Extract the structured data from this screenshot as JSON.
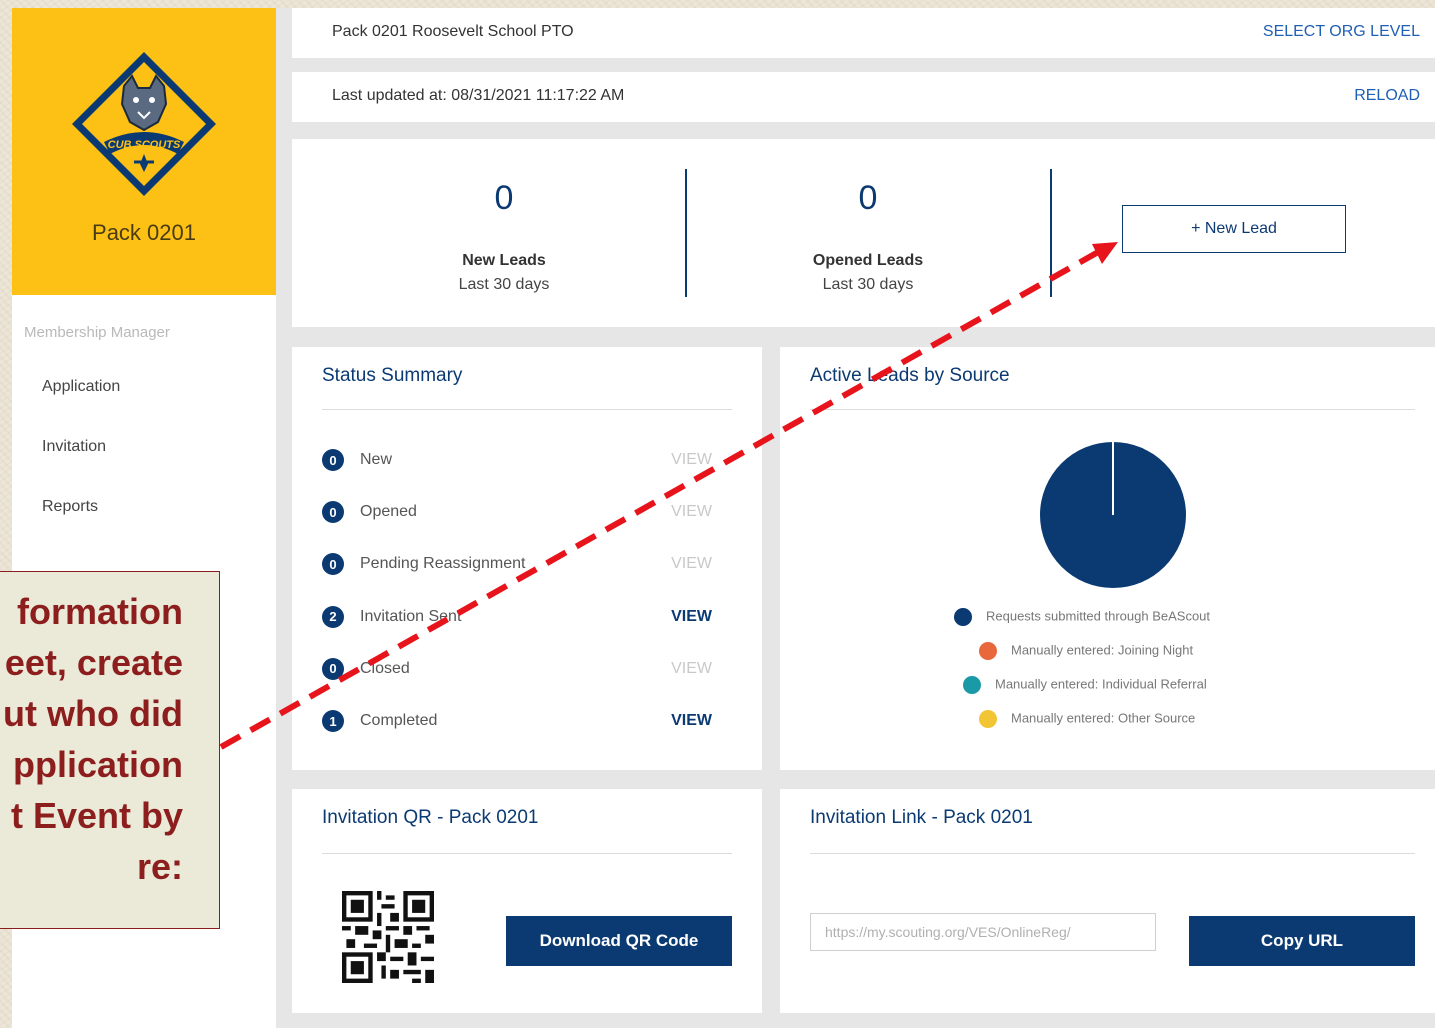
{
  "sidebar": {
    "pack_name": "Pack 0201",
    "section_label": "Membership Manager",
    "items": [
      {
        "label": "Application"
      },
      {
        "label": "Invitation"
      },
      {
        "label": "Reports"
      }
    ]
  },
  "header": {
    "org_name": "Pack 0201 Roosevelt School PTO",
    "select_org_level": "SELECT ORG LEVEL",
    "last_updated": "Last updated at: 08/31/2021 11:17:22 AM",
    "reload": "RELOAD"
  },
  "stats": {
    "new_leads": {
      "count": "0",
      "label": "New Leads",
      "period": "Last 30 days"
    },
    "opened_leads": {
      "count": "0",
      "label": "Opened Leads",
      "period": "Last 30 days"
    },
    "new_lead_button": "+ New Lead"
  },
  "status_summary": {
    "title": "Status Summary",
    "rows": [
      {
        "count": "0",
        "label": "New",
        "view": "VIEW",
        "active": false
      },
      {
        "count": "0",
        "label": "Opened",
        "view": "VIEW",
        "active": false
      },
      {
        "count": "0",
        "label": "Pending Reassignment",
        "view": "VIEW",
        "active": false
      },
      {
        "count": "2",
        "label": "Invitation Sent",
        "view": "VIEW",
        "active": true
      },
      {
        "count": "0",
        "label": "Closed",
        "view": "VIEW",
        "active": false
      },
      {
        "count": "1",
        "label": "Completed",
        "view": "VIEW",
        "active": true
      }
    ]
  },
  "chart_data": {
    "type": "pie",
    "title": "Active Leads by Source",
    "categories": [
      "Requests submitted through BeAScout",
      "Manually entered: Joining Night",
      "Manually entered: Individual Referral",
      "Manually entered: Other Source"
    ],
    "values": [
      1,
      0,
      0,
      0
    ],
    "colors": [
      "#0b3a73",
      "#e8673b",
      "#1a9aa6",
      "#f2c535"
    ],
    "legend": "bottom"
  },
  "qr": {
    "title": "Invitation QR - Pack 0201",
    "download_label": "Download QR Code"
  },
  "invite_link": {
    "title": "Invitation Link - Pack 0201",
    "url": "https://my.scouting.org/VES/OnlineReg/",
    "copy_label": "Copy URL"
  },
  "callout": {
    "text": "formation\neet, create\nut who did\npplication\nt Event by\nre:"
  },
  "annotation": {
    "color": "#e8141c"
  }
}
